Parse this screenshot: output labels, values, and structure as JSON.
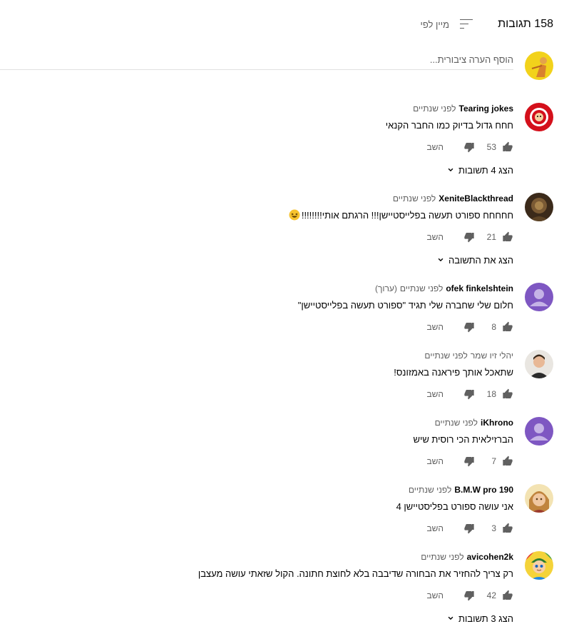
{
  "header": {
    "count_label": "158 תגובות",
    "sort_label": "מיין לפי"
  },
  "add_comment": {
    "placeholder": "הוסף הערה ציבורית..."
  },
  "reply_label": "השב",
  "comments": [
    {
      "author": "Tearing jokes",
      "time": "לפני שנתיים",
      "text": "חחח גדול בדיוק כמו החבר הקנאי",
      "likes": "53",
      "replies_label": "הצג 4 תשובות"
    },
    {
      "author": "XeniteBlackthread",
      "time": "לפני שנתיים",
      "text": "חחחחח ספורט תעשה בפלייסטיישן!!! הרגתם אותי!!!!!!!!",
      "likes": "21",
      "replies_label": "הצג את התשובה"
    },
    {
      "author": "ofek finkelshtein",
      "time": "לפני שנתיים",
      "edited": "(ערוך)",
      "text": "חלום שלי שחברה שלי תגיד \"ספורט תעשה בפלייסטיישן\"",
      "likes": "8"
    },
    {
      "author": "יהלי זיו שמר",
      "time": "לפני שנתיים",
      "text": "שתאכל אותך פיראנה באמזונס!",
      "likes": "18"
    },
    {
      "author": "iKhrono",
      "time": "לפני שנתיים",
      "text": "הברזילאית הכי רוסית שיש",
      "likes": "7"
    },
    {
      "author": "B.M.W pro 190",
      "time": "לפני שנתיים",
      "text": "אני עושה ספורט בפליסטיישן 4",
      "likes": "3"
    },
    {
      "author": "avicohen2k",
      "time": "לפני שנתיים",
      "text": "רק צריך להחזיר את הבחורה שדיבבה בלא לחוצת חתונה. הקול שזאתי עושה מעצבן",
      "likes": "42",
      "replies_label": "הצג 3 תשובות"
    }
  ]
}
